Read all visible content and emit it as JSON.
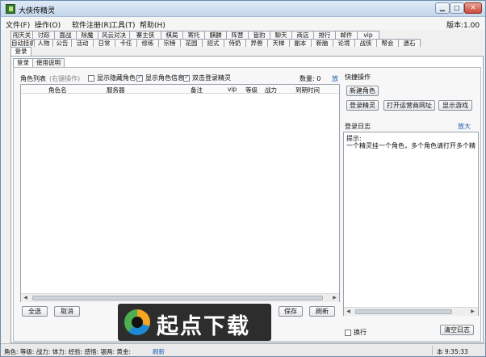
{
  "window": {
    "title": "大侠传精灵",
    "version": "版本:1.00"
  },
  "menu": [
    "文件(F)",
    "操作(O)",
    "软件注册(R)",
    "工具(T)",
    "帮助(H)"
  ],
  "tabs_row1": [
    "闯天关",
    "讨踪",
    "面战",
    "除魔",
    "风云对决",
    "寨主侠",
    "棋局",
    "寄托",
    "麒麟",
    "阵营",
    "皆豹",
    "聊天",
    "商店",
    "排行",
    "邮件",
    "vip"
  ],
  "tabs_row2": [
    "自动挂机",
    "人物",
    "公告",
    "活动",
    "日常",
    "卡任",
    "修练",
    "宗榜",
    "花园",
    "招式",
    "侍奶",
    "异兽",
    "天梯",
    "副本",
    "新脑",
    "论境",
    "战侠",
    "帮会",
    "遗石"
  ],
  "tabs_row3": [
    "登录"
  ],
  "subtabs": [
    "登录",
    "使用说明"
  ],
  "roles": {
    "label": "角色列表",
    "hint": "(右键操作)",
    "opt_hide": "显示隐藏角色",
    "opt_info": "显示角色信息",
    "opt_dbl": "双击登录精灵",
    "count": "数量: 0",
    "expand": "放大",
    "columns": [
      "角色名",
      "服务器",
      "备注",
      "vip",
      "等级",
      "战力",
      "到期时间"
    ],
    "btn_select_all": "全选",
    "btn_cancel": "取消",
    "btn_save": "保存",
    "btn_refresh": "刷新"
  },
  "quick": {
    "title": "快捷操作",
    "btn_new_role": "新建角色",
    "btn_login": "登录精灵",
    "btn_open_site": "打开运营商网址",
    "btn_show_game": "显示游戏"
  },
  "log": {
    "title": "登录日志",
    "expand": "放大",
    "head": "提示:",
    "text": "一个精灵挂一个角色，多个角色请打开多个精灵",
    "wrap": "换行",
    "btn_clear": "清空日志"
  },
  "watermark": "起点下载",
  "status": {
    "text": "角色:  等级:  战力:  体力:  经验:  感悟:  银两:  黄金:",
    "refresh": "刷新",
    "clock": "本 9:35:33"
  }
}
